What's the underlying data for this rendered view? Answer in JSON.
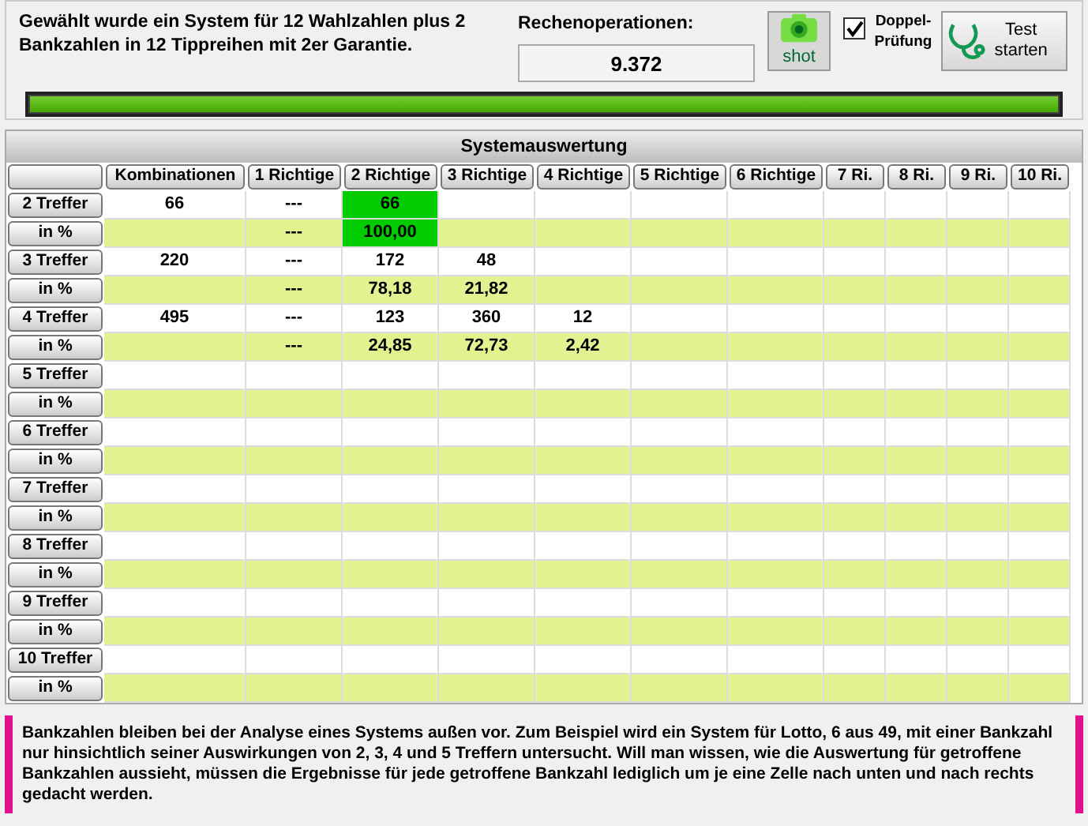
{
  "summary": "Gewählt wurde ein System für 12 Wahlzahlen plus 2 Bankzahlen in 12 Tippreihen mit 2er Garantie.",
  "operations": {
    "label": "Rechenoperationen:",
    "value": "9.372"
  },
  "shot_button": {
    "label": "shot"
  },
  "double_check": {
    "label": "Doppel-Prüfung",
    "checked": true
  },
  "test_button": {
    "label": "Test starten"
  },
  "progress": {
    "level": 1
  },
  "table": {
    "title": "Systemauswertung",
    "columns": [
      "Kombinationen",
      "1 Richtige",
      "2 Richtige",
      "3 Richtige",
      "4 Richtige",
      "5 Richtige",
      "6 Richtige",
      "7 Ri.",
      "8 Ri.",
      "9 Ri.",
      "10 Ri."
    ],
    "rows": [
      {
        "label": "2 Treffer",
        "kind": "count",
        "cells": [
          {
            "text": "66",
            "highlighted": false
          },
          {
            "text": "---",
            "highlighted": false
          },
          {
            "text": "66",
            "highlighted": true
          }
        ]
      },
      {
        "label": "in %",
        "kind": "percent",
        "cells": [
          null,
          {
            "text": "---",
            "highlighted": false
          },
          {
            "text": "100,00",
            "highlighted": true
          }
        ]
      },
      {
        "label": "3 Treffer",
        "kind": "count",
        "cells": [
          {
            "text": "220",
            "highlighted": false
          },
          {
            "text": "---",
            "highlighted": false
          },
          {
            "text": "172",
            "highlighted": false
          },
          {
            "text": "48",
            "highlighted": false
          }
        ]
      },
      {
        "label": "in %",
        "kind": "percent",
        "cells": [
          null,
          {
            "text": "---",
            "highlighted": false
          },
          {
            "text": "78,18",
            "highlighted": false
          },
          {
            "text": "21,82",
            "highlighted": false
          }
        ]
      },
      {
        "label": "4 Treffer",
        "kind": "count",
        "cells": [
          {
            "text": "495",
            "highlighted": false
          },
          {
            "text": "---",
            "highlighted": false
          },
          {
            "text": "123",
            "highlighted": false
          },
          {
            "text": "360",
            "highlighted": false
          },
          {
            "text": "12",
            "highlighted": false
          }
        ]
      },
      {
        "label": "in %",
        "kind": "percent",
        "cells": [
          null,
          {
            "text": "---",
            "highlighted": false
          },
          {
            "text": "24,85",
            "highlighted": false
          },
          {
            "text": "72,73",
            "highlighted": false
          },
          {
            "text": "2,42",
            "highlighted": false
          }
        ]
      },
      {
        "label": "5 Treffer",
        "kind": "count"
      },
      {
        "label": "in %",
        "kind": "percent"
      },
      {
        "label": "6 Treffer",
        "kind": "count"
      },
      {
        "label": "in %",
        "kind": "percent"
      },
      {
        "label": "7 Treffer",
        "kind": "count"
      },
      {
        "label": "in %",
        "kind": "percent"
      },
      {
        "label": "8 Treffer",
        "kind": "count"
      },
      {
        "label": "in %",
        "kind": "percent"
      },
      {
        "label": "9 Treffer",
        "kind": "count"
      },
      {
        "label": "in %",
        "kind": "percent"
      },
      {
        "label": "10 Treffer",
        "kind": "count"
      },
      {
        "label": "in %",
        "kind": "percent"
      }
    ]
  },
  "note": "Bankzahlen bleiben bei der Analyse eines Systems außen vor. Zum Beispiel wird ein System für Lotto, 6 aus 49, mit einer Bankzahl nur hinsichtlich seiner Auswirkungen von 2, 3, 4 und 5 Treffern untersucht. Will man wissen, wie die Auswertung für getroffene Bankzahlen aussieht, müssen die Ergebnisse für jede getroffene Bankzahl lediglich um je eine Zelle nach unten und nach rechts gedacht werden."
}
